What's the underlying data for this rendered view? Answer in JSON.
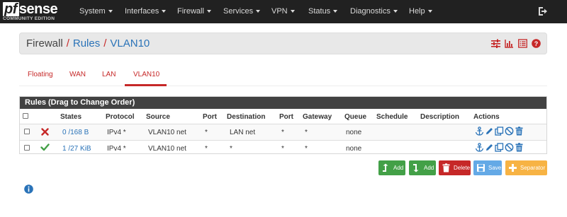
{
  "brand": {
    "logo_pf": "pf",
    "logo_sense": "sense",
    "edition": "COMMUNITY EDITION",
    "logo_icon": "pfsense-logo"
  },
  "nav": {
    "items": [
      {
        "label": "System"
      },
      {
        "label": "Interfaces"
      },
      {
        "label": "Firewall"
      },
      {
        "label": "Services"
      },
      {
        "label": "VPN"
      },
      {
        "label": "Status"
      },
      {
        "label": "Diagnostics"
      },
      {
        "label": "Help"
      }
    ],
    "logout_icon": "logout-icon"
  },
  "breadcrumb": {
    "root": "Firewall",
    "sep1": "/",
    "level1": "Rules",
    "sep2": "/",
    "level2": "VLAN10",
    "icons": [
      "sliders-icon",
      "bar-chart-icon",
      "list-icon",
      "help-icon"
    ]
  },
  "tabs": [
    {
      "label": "Floating",
      "active": false
    },
    {
      "label": "WAN",
      "active": false
    },
    {
      "label": "LAN",
      "active": false
    },
    {
      "label": "VLAN10",
      "active": true
    }
  ],
  "rules": {
    "panel_title": "Rules (Drag to Change Order)",
    "columns": [
      "States",
      "Protocol",
      "Source",
      "Port",
      "Destination",
      "Port",
      "Gateway",
      "Queue",
      "Schedule",
      "Description",
      "Actions"
    ],
    "rows": [
      {
        "status_icon": "block-x-icon",
        "states": "0 /168 B",
        "protocol": "IPv4 *",
        "source": "VLAN10 net",
        "src_port": "*",
        "destination": "LAN net",
        "dst_port": "*",
        "gateway": "*",
        "queue": "none",
        "schedule": "",
        "description": ""
      },
      {
        "status_icon": "pass-check-icon",
        "states": "1 /27 KiB",
        "protocol": "IPv4 *",
        "source": "VLAN10 net",
        "src_port": "*",
        "destination": "*",
        "dst_port": "*",
        "gateway": "*",
        "queue": "none",
        "schedule": "",
        "description": ""
      }
    ],
    "action_icons": [
      "anchor-icon",
      "pencil-icon",
      "copy-icon",
      "disable-icon",
      "trash-icon"
    ]
  },
  "buttons": {
    "add_top": "Add",
    "add_bottom": "Add",
    "delete": "Delete",
    "save": "Save",
    "separator": "Separator"
  },
  "colors": {
    "navbar": "#212121",
    "accent_red": "#c62828",
    "link_blue": "#2a73b8",
    "success_green": "#43a047",
    "save_blue": "#64a9e6",
    "warning_orange": "#f7b344"
  }
}
